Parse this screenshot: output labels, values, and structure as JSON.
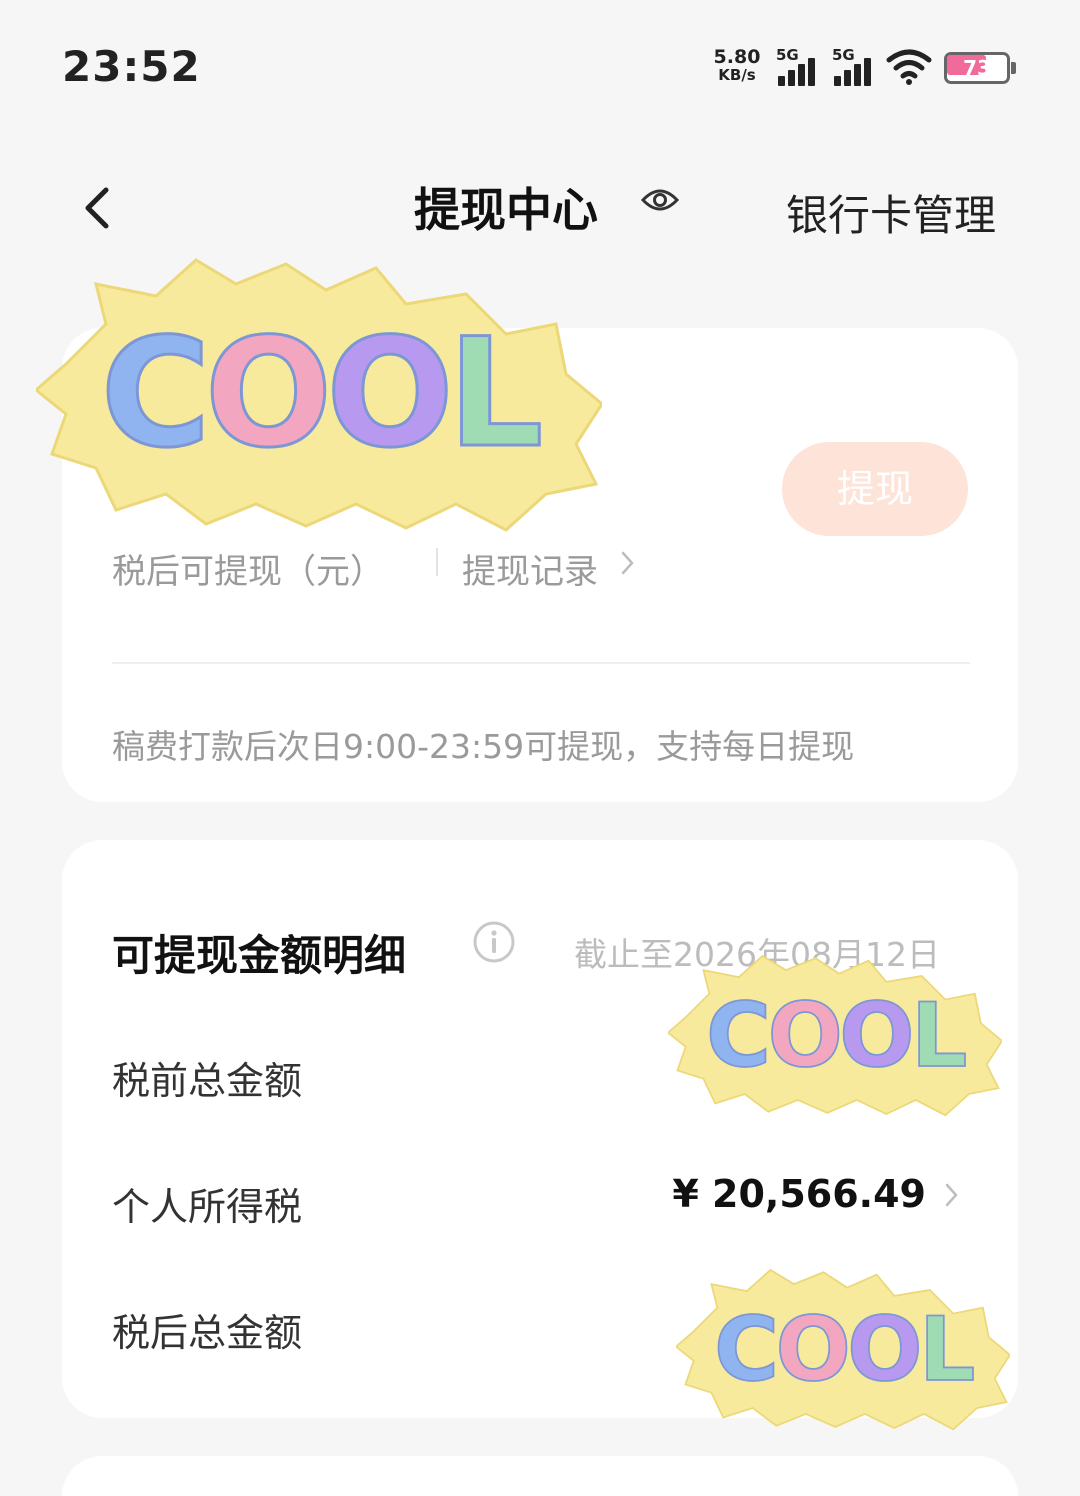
{
  "status_bar": {
    "time": "23:52",
    "net_speed_value": "5.80",
    "net_speed_unit": "KB/s",
    "signal_1_label": "5G",
    "signal_2_label": "5G",
    "wifi_icon": "wifi-icon",
    "battery_level": "73",
    "battery_fraction": 0.73,
    "battery_fill_color": "#f06a9b"
  },
  "nav": {
    "back_icon": "chevron-left-icon",
    "title": "提现中心",
    "eye_icon": "eye-icon",
    "right_action": "银行卡管理"
  },
  "withdraw_card": {
    "available_label": "税后可提现（元）",
    "record_link": "提现记录",
    "withdraw_button": "提现",
    "notice": "稿费打款后次日9:00-23:59可提现，支持每日提现",
    "button_color": "#fde3d8"
  },
  "detail_card": {
    "title": "可提现金额明细",
    "info_icon": "info-icon",
    "as_of": "截止至2026年08月12日",
    "rows": [
      {
        "label": "税前总金额",
        "value": ""
      },
      {
        "label": "个人所得税",
        "value": "¥ 20,566.49"
      },
      {
        "label": "税后总金额",
        "value": ""
      }
    ]
  },
  "stickers": {
    "text": "COOL",
    "letter_colors": [
      "#8fb4ef",
      "#f2a6bf",
      "#b79af0",
      "#9fdcb4"
    ],
    "backing_color": "#f8ea9c"
  }
}
